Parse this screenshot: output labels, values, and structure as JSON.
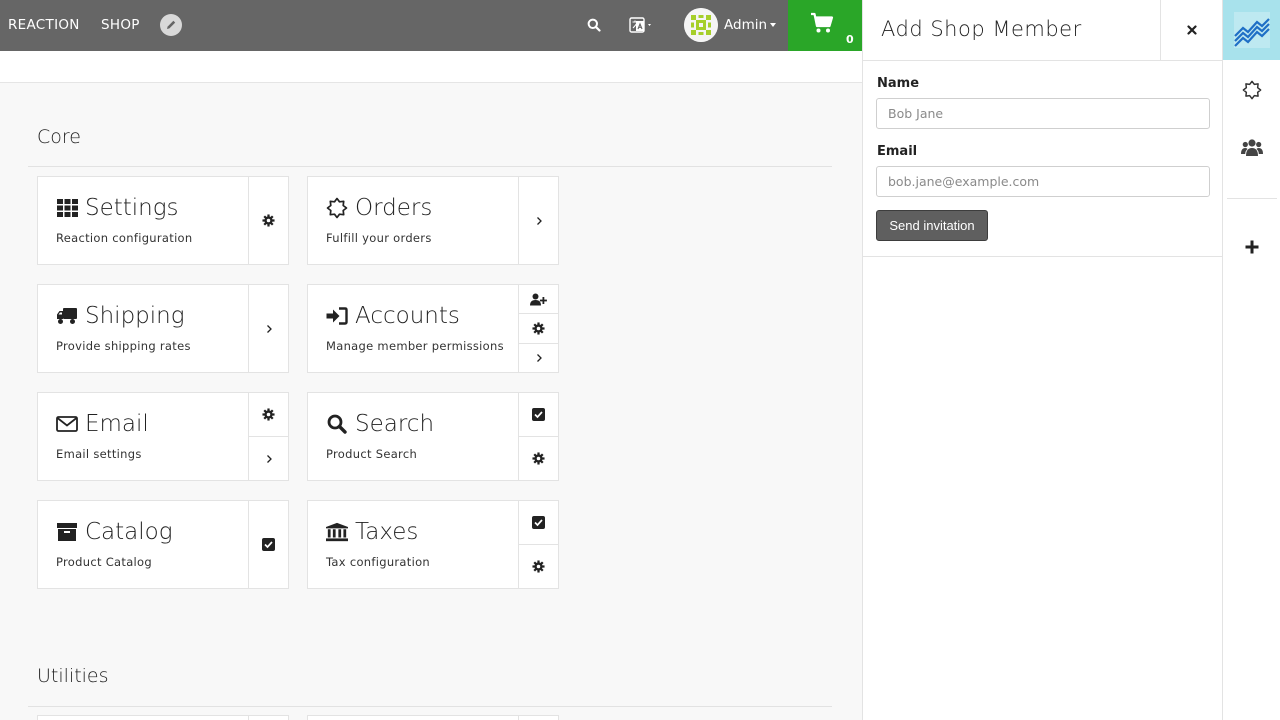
{
  "nav": {
    "brand": "REACTION",
    "shop": "SHOP",
    "user": "Admin",
    "cart_count": "0",
    "cart_color": "#2aa628",
    "bar_color": "#666666"
  },
  "sections": [
    {
      "title": "Core"
    },
    {
      "title": "Utilities"
    }
  ],
  "cards": [
    {
      "title": "Settings",
      "description": "Reaction configuration",
      "icon": "grid-icon",
      "actions": [
        "gear-icon"
      ]
    },
    {
      "title": "Orders",
      "description": "Fulfill your orders",
      "icon": "sun-icon",
      "actions": [
        "chevron-right-icon"
      ]
    },
    {
      "title": "Shipping",
      "description": "Provide shipping rates",
      "icon": "truck-icon",
      "actions": [
        "chevron-right-icon"
      ]
    },
    {
      "title": "Accounts",
      "description": "Manage member permissions",
      "icon": "sign-in-icon",
      "actions": [
        "user-plus-icon",
        "gear-icon",
        "chevron-right-icon"
      ]
    },
    {
      "title": "Email",
      "description": "Email settings",
      "icon": "envelope-icon",
      "actions": [
        "gear-icon",
        "chevron-right-icon"
      ]
    },
    {
      "title": "Search",
      "description": "Product Search",
      "icon": "search-icon",
      "actions": [
        "checkbox-checked-icon",
        "gear-icon"
      ]
    },
    {
      "title": "Catalog",
      "description": "Product Catalog",
      "icon": "archive-icon",
      "actions": [
        "checkbox-checked-icon"
      ]
    },
    {
      "title": "Taxes",
      "description": "Tax configuration",
      "icon": "bank-icon",
      "actions": [
        "checkbox-checked-icon",
        "gear-icon"
      ]
    }
  ],
  "panel": {
    "title": "Add Shop Member",
    "name_label": "Name",
    "name_placeholder": "Bob Jane",
    "email_label": "Email",
    "email_placeholder": "bob.jane@example.com",
    "submit": "Send invitation"
  },
  "rail": {
    "accent": "#a8e2ec",
    "icons": [
      "dashboard-logo-icon",
      "sun-icon",
      "users-icon",
      "plus-icon"
    ]
  }
}
